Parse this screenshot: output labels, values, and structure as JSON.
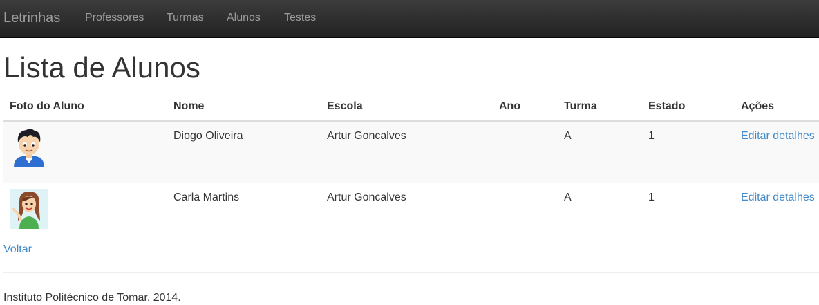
{
  "navbar": {
    "brand": "Letrinhas",
    "links": [
      "Professores",
      "Turmas",
      "Alunos",
      "Testes"
    ]
  },
  "page_title": "Lista de Alunos",
  "table": {
    "headers": [
      "Foto do Aluno",
      "Nome",
      "Escola",
      "Ano",
      "Turma",
      "Estado",
      "Ações"
    ],
    "rows": [
      {
        "photo_icon": "boy-avatar-icon",
        "nome": "Diogo Oliveira",
        "escola": "Artur Goncalves",
        "ano": "",
        "turma": "A",
        "estado": "1",
        "acao": "Editar detalhes"
      },
      {
        "photo_icon": "girl-avatar-icon",
        "nome": "Carla Martins",
        "escola": "Artur Goncalves",
        "ano": "",
        "turma": "A",
        "estado": "1",
        "acao": "Editar detalhes"
      }
    ]
  },
  "back_link": "Voltar",
  "footer": "Instituto Politécnico de Tomar, 2014.",
  "colors": {
    "navbar": "#222222",
    "link": "#428bca",
    "text": "#333333"
  }
}
